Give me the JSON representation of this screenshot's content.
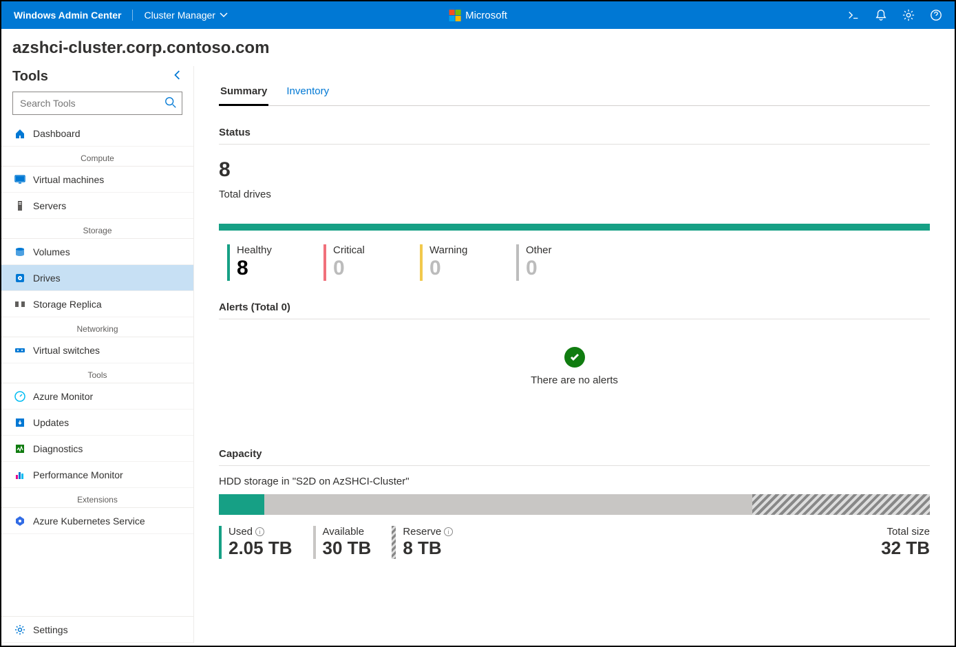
{
  "topbar": {
    "brand": "Windows Admin Center",
    "context": "Cluster Manager",
    "center": "Microsoft"
  },
  "cluster_title": "azshci-cluster.corp.contoso.com",
  "sidebar": {
    "title": "Tools",
    "search_placeholder": "Search Tools",
    "groups": {
      "compute": "Compute",
      "storage": "Storage",
      "networking": "Networking",
      "tools": "Tools",
      "extensions": "Extensions"
    },
    "items": {
      "dashboard": "Dashboard",
      "vms": "Virtual machines",
      "servers": "Servers",
      "volumes": "Volumes",
      "drives": "Drives",
      "storage_replica": "Storage Replica",
      "vswitches": "Virtual switches",
      "azure_monitor": "Azure Monitor",
      "updates": "Updates",
      "diagnostics": "Diagnostics",
      "perfmon": "Performance Monitor",
      "aks": "Azure Kubernetes Service",
      "settings": "Settings"
    }
  },
  "tabs": {
    "summary": "Summary",
    "inventory": "Inventory"
  },
  "status": {
    "heading": "Status",
    "total_value": "8",
    "total_label": "Total drives",
    "healthy_label": "Healthy",
    "healthy_value": "8",
    "critical_label": "Critical",
    "critical_value": "0",
    "warning_label": "Warning",
    "warning_value": "0",
    "other_label": "Other",
    "other_value": "0"
  },
  "alerts": {
    "heading": "Alerts (Total 0)",
    "empty_message": "There are no alerts"
  },
  "capacity": {
    "heading": "Capacity",
    "description": "HDD storage in \"S2D on AzSHCI-Cluster\"",
    "used_label": "Used",
    "used_value": "2.05 TB",
    "available_label": "Available",
    "available_value": "30 TB",
    "reserve_label": "Reserve",
    "reserve_value": "8 TB",
    "total_label": "Total size",
    "total_value": "32 TB",
    "used_pct": 6.4,
    "reserve_pct": 25
  }
}
